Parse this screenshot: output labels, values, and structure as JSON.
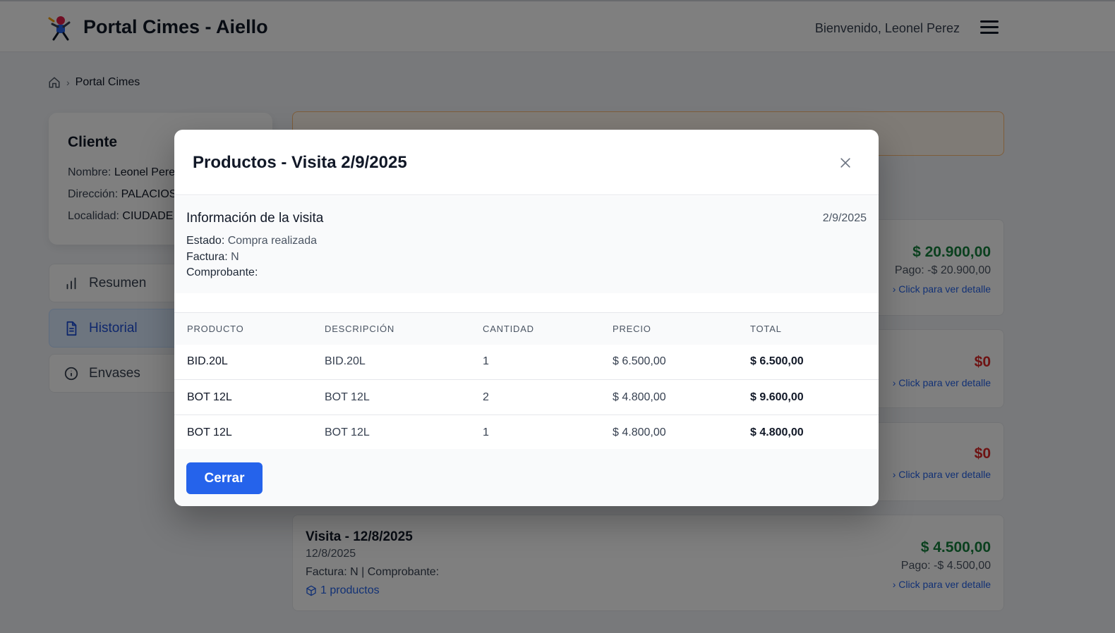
{
  "header": {
    "app_title": "Portal Cimes - Aiello",
    "welcome": "Bienvenido, Leonel Perez"
  },
  "breadcrumb": {
    "current": "Portal Cimes"
  },
  "client": {
    "title": "Cliente",
    "rows": [
      {
        "label": "Nombre:",
        "value": "Leonel Perez"
      },
      {
        "label": "Dirección:",
        "value": "PALACIOS"
      },
      {
        "label": "Localidad:",
        "value": "CIUDADE"
      }
    ]
  },
  "nav": {
    "items": [
      {
        "label": "Resumen",
        "icon": "bar-chart-icon"
      },
      {
        "label": "Historial",
        "icon": "document-icon"
      },
      {
        "label": "Envases",
        "icon": "info-icon"
      }
    ]
  },
  "visits": [
    {
      "amount": "$ 20.900,00",
      "pago": "Pago: -$ 20.900,00",
      "detail": "Click para ver detalle"
    },
    {
      "amount": "$0",
      "detail": "Click para ver detalle"
    },
    {
      "amount": "$0",
      "detail": "Click para ver detalle"
    },
    {
      "title": "Visita - 12/8/2025",
      "date": "12/8/2025",
      "factura": "Factura: N | Comprobante:",
      "products": "1 productos",
      "amount": "$ 4.500,00",
      "pago": "Pago: -$ 4.500,00",
      "detail": "Click para ver detalle"
    }
  ],
  "modal": {
    "title": "Productos - Visita 2/9/2025",
    "info": {
      "title": "Información de la visita",
      "date": "2/9/2025",
      "estado_label": "Estado:",
      "estado_value": "Compra realizada",
      "factura_label": "Factura:",
      "factura_value": "N",
      "comprobante_label": "Comprobante:",
      "comprobante_value": ""
    },
    "table": {
      "headers": [
        "PRODUCTO",
        "DESCRIPCIÓN",
        "CANTIDAD",
        "PRECIO",
        "TOTAL"
      ],
      "rows": [
        [
          "BID.20L",
          "BID.20L",
          "1",
          "$ 6.500,00",
          "$ 6.500,00"
        ],
        [
          "BOT 12L",
          "BOT 12L",
          "2",
          "$ 4.800,00",
          "$ 9.600,00"
        ],
        [
          "BOT 12L",
          "BOT 12L",
          "1",
          "$ 4.800,00",
          "$ 4.800,00"
        ]
      ]
    },
    "close_button": "Cerrar"
  },
  "colors": {
    "primary": "#2563eb",
    "positive": "#15803d",
    "negative": "#dc2626"
  }
}
